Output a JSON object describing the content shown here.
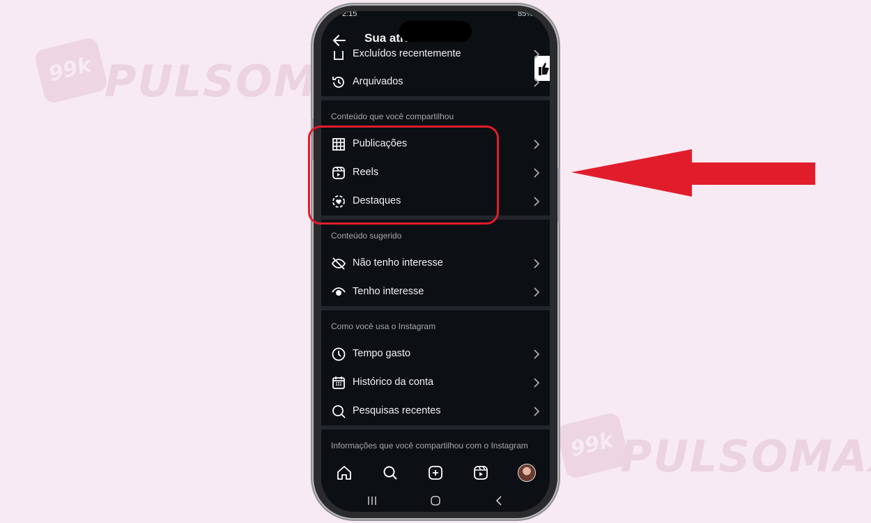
{
  "watermark": {
    "text": "PULSOMAX",
    "badge": "99k"
  },
  "status_bar": {
    "left": "2:15",
    "right": "85%"
  },
  "header": {
    "title": "Sua atividade"
  },
  "rows_top": [
    {
      "label": "Excluídos recentemente"
    },
    {
      "label": "Arquivados"
    }
  ],
  "sections": [
    {
      "heading": "Conteúdo que você compartilhou",
      "items": [
        "Publicações",
        "Reels",
        "Destaques"
      ]
    },
    {
      "heading": "Conteúdo sugerido",
      "items": [
        "Não tenho interesse",
        "Tenho interesse"
      ]
    },
    {
      "heading": "Como você usa o Instagram",
      "items": [
        "Tempo gasto",
        "Histórico da conta",
        "Pesquisas recentes"
      ]
    },
    {
      "heading": "Informações que você compartilhou com o Instagram",
      "items": []
    }
  ],
  "bottom_nav": [
    "home-icon",
    "search-icon",
    "create-icon",
    "reels-icon",
    "profile-avatar"
  ],
  "colors": {
    "highlight": "#e21d2b",
    "screen_bg": "#0c0f14",
    "page_bg": "#f7eaf3"
  }
}
